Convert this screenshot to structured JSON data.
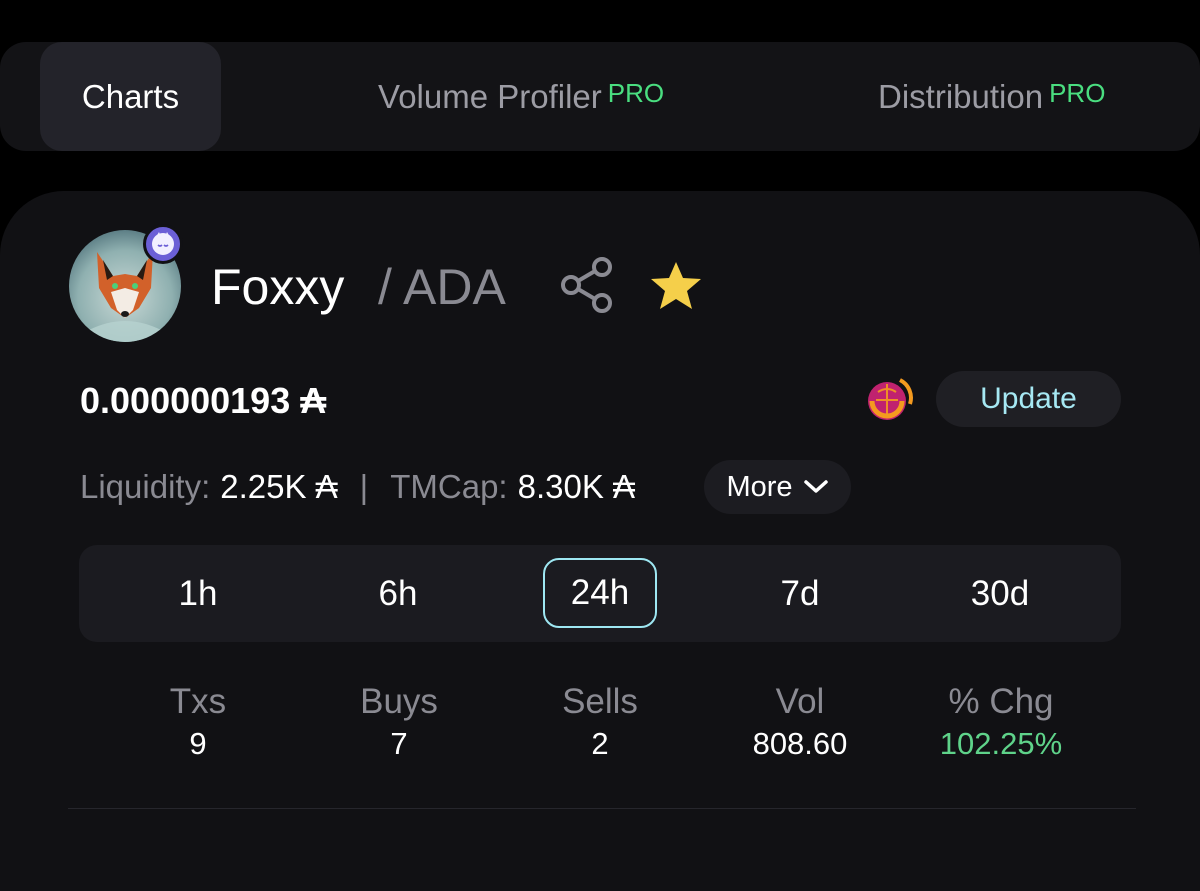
{
  "tabs": [
    {
      "label": "Charts",
      "badge": ""
    },
    {
      "label": "Volume Profiler",
      "badge": "PRO"
    },
    {
      "label": "Distribution",
      "badge": "PRO"
    }
  ],
  "token": {
    "name": "Foxxy",
    "quote": "/ ADA",
    "price": "0.000000193 ₳"
  },
  "update_label": "Update",
  "stats": {
    "liquidity_label": "Liquidity:",
    "liquidity_value": "2.25K ₳",
    "separator": "|",
    "tmcap_label": "TMCap:",
    "tmcap_value": "8.30K ₳",
    "more_label": "More"
  },
  "ranges": [
    "1h",
    "6h",
    "24h",
    "7d",
    "30d"
  ],
  "selected_range": "24h",
  "metrics": [
    {
      "label": "Txs",
      "value": "9"
    },
    {
      "label": "Buys",
      "value": "7"
    },
    {
      "label": "Sells",
      "value": "2"
    },
    {
      "label": "Vol",
      "value": "808.60"
    },
    {
      "label": "% Chg",
      "value": "102.25%"
    }
  ],
  "colors": {
    "pro_badge": "#4ade80",
    "update_text": "#a6e8f3",
    "star": "#f5cf4a",
    "positive_change": "#5fd38a",
    "selected_range_border": "#9ee7f2"
  },
  "icons": [
    "fox-avatar",
    "app-badge-icon",
    "share-icon",
    "star-icon",
    "update-logo-icon",
    "chevron-down-icon"
  ]
}
